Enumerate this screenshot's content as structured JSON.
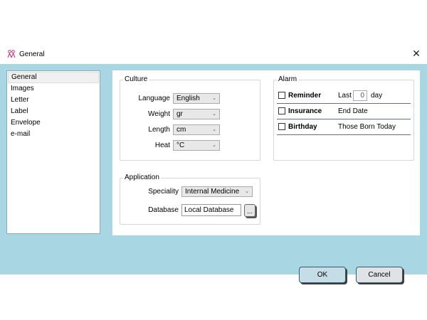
{
  "window": {
    "title": "General",
    "close_glyph": "✕",
    "icon": "people-icon"
  },
  "sidebar": {
    "items": [
      {
        "label": "General",
        "selected": true
      },
      {
        "label": "Images"
      },
      {
        "label": "Letter"
      },
      {
        "label": "Label"
      },
      {
        "label": "Envelope"
      },
      {
        "label": "e-mail"
      }
    ]
  },
  "culture": {
    "title": "Culture",
    "language": {
      "label": "Language",
      "value": "English"
    },
    "weight": {
      "label": "Weight",
      "value": "gr"
    },
    "length": {
      "label": "Length",
      "value": "cm"
    },
    "heat": {
      "label": "Heat",
      "value": "°C"
    }
  },
  "alarm": {
    "title": "Alarm",
    "reminder": {
      "label": "Reminder",
      "prefix": "Last",
      "value": "0",
      "unit": "day"
    },
    "insurance": {
      "label": "Insurance",
      "desc": "End Date"
    },
    "birthday": {
      "label": "Birthday",
      "desc": "Those Born Today"
    }
  },
  "application": {
    "title": "Application",
    "speciality": {
      "label": "Speciality",
      "value": "Internal Medicine"
    },
    "database": {
      "label": "Database",
      "value": "Local Database",
      "browse_label": "..."
    }
  },
  "buttons": {
    "ok": "OK",
    "cancel": "Cancel"
  },
  "colors": {
    "client_bg": "#a9d6e3",
    "icon_accent": "#c0307a"
  }
}
